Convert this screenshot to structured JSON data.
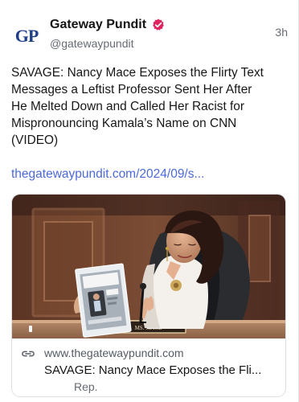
{
  "post": {
    "display_name": "Gateway Pundit",
    "handle": "@gatewaypundit",
    "time": "3h",
    "avatar_initials": "GP",
    "text": "SAVAGE: Nancy Mace Exposes the Flirty Text\nMessages a Leftist Professor Sent Her After\nHe Melted Down and Called Her Racist for\nMispronouncing Kamala’s Name on CNN\n(VIDEO)",
    "link": "thegatewaypundit.com/2024/09/s..."
  },
  "card": {
    "domain": "www.thegatewaypundit.com",
    "title": "SAVAGE: Nancy Mace Exposes the Fli...",
    "subtitle": "Rep.",
    "nameplate": "MS. MACE"
  },
  "icons": {
    "verified": "verified-badge-icon",
    "link": "link-icon"
  },
  "colors": {
    "link": "#4b6ad8",
    "verified": "#e0245e",
    "avatar": "#1f3f86"
  }
}
